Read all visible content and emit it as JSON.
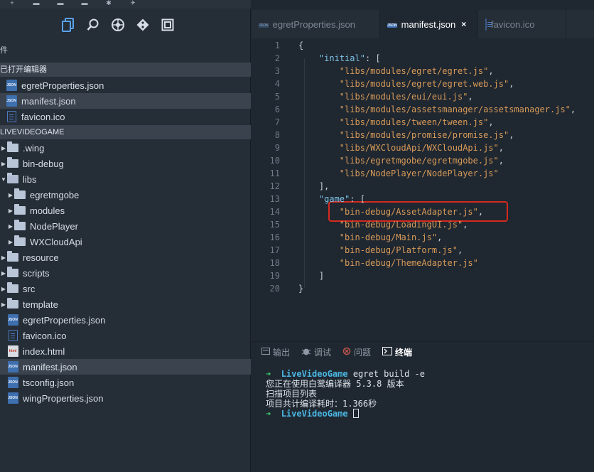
{
  "sidebar": {
    "pane_label": "件",
    "open_editors_title": "已打开编辑器",
    "open_editors": [
      {
        "label": "egretProperties.json",
        "icon": "json-file-icon"
      },
      {
        "label": "manifest.json",
        "icon": "json-file-icon",
        "selected": true
      },
      {
        "label": "favicon.ico",
        "icon": "document-icon"
      }
    ],
    "project_title": "LIVEVIDEOGAME",
    "tree": [
      {
        "label": ".wing",
        "type": "folder"
      },
      {
        "label": "bin-debug",
        "type": "folder"
      },
      {
        "label": "libs",
        "type": "folder-open"
      },
      {
        "label": "egretmgobe",
        "type": "folder",
        "indent": 1
      },
      {
        "label": "modules",
        "type": "folder",
        "indent": 1
      },
      {
        "label": "NodePlayer",
        "type": "folder",
        "indent": 1
      },
      {
        "label": "WXCloudApi",
        "type": "folder",
        "indent": 1
      },
      {
        "label": "resource",
        "type": "folder"
      },
      {
        "label": "scripts",
        "type": "folder"
      },
      {
        "label": "src",
        "type": "folder"
      },
      {
        "label": "template",
        "type": "folder"
      },
      {
        "label": "egretProperties.json",
        "type": "json"
      },
      {
        "label": "favicon.ico",
        "type": "doc"
      },
      {
        "label": "index.html",
        "type": "html"
      },
      {
        "label": "manifest.json",
        "type": "json",
        "selected": true
      },
      {
        "label": "tsconfig.json",
        "type": "json"
      },
      {
        "label": "wingProperties.json",
        "type": "json"
      }
    ]
  },
  "tabs": [
    {
      "label": "egretProperties.json",
      "active": false
    },
    {
      "label": "manifest.json",
      "active": true,
      "close": "×"
    },
    {
      "label": "favicon.ico",
      "active": false
    }
  ],
  "code": [
    {
      "n": "1",
      "text": "{"
    },
    {
      "n": "2",
      "indent": "    ",
      "key": "\"initial\"",
      "rest": ": ["
    },
    {
      "n": "3",
      "indent": "        ",
      "str": "\"libs/modules/egret/egret.js\"",
      "rest": ","
    },
    {
      "n": "4",
      "indent": "        ",
      "str": "\"libs/modules/egret/egret.web.js\"",
      "rest": ","
    },
    {
      "n": "5",
      "indent": "        ",
      "str": "\"libs/modules/eui/eui.js\"",
      "rest": ","
    },
    {
      "n": "6",
      "indent": "        ",
      "str": "\"libs/modules/assetsmanager/assetsmanager.js\"",
      "rest": ","
    },
    {
      "n": "7",
      "indent": "        ",
      "str": "\"libs/modules/tween/tween.js\"",
      "rest": ","
    },
    {
      "n": "8",
      "indent": "        ",
      "str": "\"libs/modules/promise/promise.js\"",
      "rest": ","
    },
    {
      "n": "9",
      "indent": "        ",
      "str": "\"libs/WXCloudApi/WXCloudApi.js\"",
      "rest": ","
    },
    {
      "n": "10",
      "indent": "        ",
      "str": "\"libs/egretmgobe/egretmgobe.js\"",
      "rest": ","
    },
    {
      "n": "11",
      "indent": "        ",
      "str": "\"libs/NodePlayer/NodePlayer.js\"",
      "rest": ""
    },
    {
      "n": "12",
      "indent": "    ",
      "text": "],"
    },
    {
      "n": "13",
      "indent": "    ",
      "key": "\"game\"",
      "rest": ": ["
    },
    {
      "n": "14",
      "indent": "        ",
      "str": "\"bin-debug/AssetAdapter.js\"",
      "rest": ","
    },
    {
      "n": "15",
      "indent": "        ",
      "str": "\"bin-debug/LoadingUI.js\"",
      "rest": ","
    },
    {
      "n": "16",
      "indent": "        ",
      "str": "\"bin-debug/Main.js\"",
      "rest": ","
    },
    {
      "n": "17",
      "indent": "        ",
      "str": "\"bin-debug/Platform.js\"",
      "rest": ","
    },
    {
      "n": "18",
      "indent": "        ",
      "str": "\"bin-debug/ThemeAdapter.js\"",
      "rest": ""
    },
    {
      "n": "19",
      "indent": "    ",
      "text": "]"
    },
    {
      "n": "20",
      "text": "}"
    }
  ],
  "panel": {
    "tabs": [
      {
        "label": "输出",
        "icon": "output-icon"
      },
      {
        "label": "调试",
        "icon": "debug-bug-icon"
      },
      {
        "label": "问题",
        "icon": "problems-icon"
      },
      {
        "label": "终端",
        "icon": "terminal-icon",
        "active": true
      }
    ],
    "terminal": {
      "prompt_arrow": "➜",
      "project": "LiveVideoGame",
      "command": " egret build -e",
      "output": [
        "您正在使用白鹭编译器 5.3.8 版本",
        "扫描项目列表",
        "项目共计编译耗时：1.366秒"
      ]
    }
  },
  "colors": {
    "highlight_box": "#d42a1e",
    "string": "#d89b58",
    "key": "#7ec3e6"
  }
}
